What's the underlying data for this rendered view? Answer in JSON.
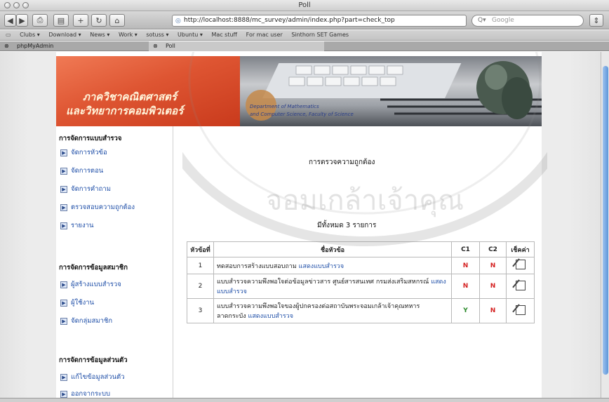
{
  "window": {
    "title": "Poll"
  },
  "toolbar": {
    "back": "◀",
    "forward": "▶",
    "add_bookmark": "+",
    "address": "http://localhost:8888/mc_survey/admin/index.php?part=check_top",
    "search_placeholder": "Google"
  },
  "bookmarks": [
    "Clubs ▾",
    "Download ▾",
    "News ▾",
    "Work ▾",
    "sotuss ▾",
    "Ubuntu ▾",
    "Mac stuff",
    "For mac user",
    "Sinthorn SET Games"
  ],
  "tabs": [
    {
      "label": "phpMyAdmin"
    },
    {
      "label": "Poll"
    }
  ],
  "sidebar": {
    "sections": [
      {
        "title": "การจัดการแบบสำรวจ",
        "items": [
          "จัดการหัวข้อ",
          "จัดการตอน",
          "จัดการคำถาม",
          "ตรวจสอบความถูกต้อง",
          "รายงาน"
        ]
      },
      {
        "title": "การจัดการข้อมูลสมาชิก",
        "items": [
          "ผู้สร้างแบบสำรวจ",
          "ผู้ใช้งาน",
          "จัดกลุ่มสมาชิก"
        ]
      },
      {
        "title": "การจัดการข้อมูลส่วนตัว",
        "items": [
          "แก้ไขข้อมูลส่วนตัว",
          "ออกจากระบบ"
        ]
      }
    ]
  },
  "content": {
    "title": "การตรวจความถูกต้อง",
    "count": "มีทั้งหมด 3 รายการ",
    "headers": [
      "หัวข้อที่",
      "ชื่อหัวข้อ",
      "C1",
      "C2",
      "เช็คค่า"
    ],
    "rows": [
      {
        "no": "1",
        "name": "ทดสอบการสร้างแบบสอบถาม",
        "link": "แสดงแบบสำรวจ",
        "c1": "N",
        "c2": "N"
      },
      {
        "no": "2",
        "name": "แบบสำรวจความพึงพอใจต่อข้อมูลข่าวสาร ศูนย์สารสนเทศ กรมส่งเสริมสหกรณ์",
        "link": "แสดงแบบสำรวจ",
        "c1": "N",
        "c2": "N"
      },
      {
        "no": "3",
        "name": "แบบสำรวจความพึงพอใจของผู้ปกครองต่อสถาบันพระจอมเกล้าเจ้าคุณทหารลาดกระบัง",
        "link": "แสดงแบบสำรวจ",
        "c1": "Y",
        "c2": "N"
      }
    ]
  },
  "watermark": "จอมเกล้าเจ้าคุณ",
  "colors": {
    "banner": "#de5532",
    "link": "#1f4fa8",
    "no": "#d42020",
    "yes": "#2a8a2a"
  }
}
